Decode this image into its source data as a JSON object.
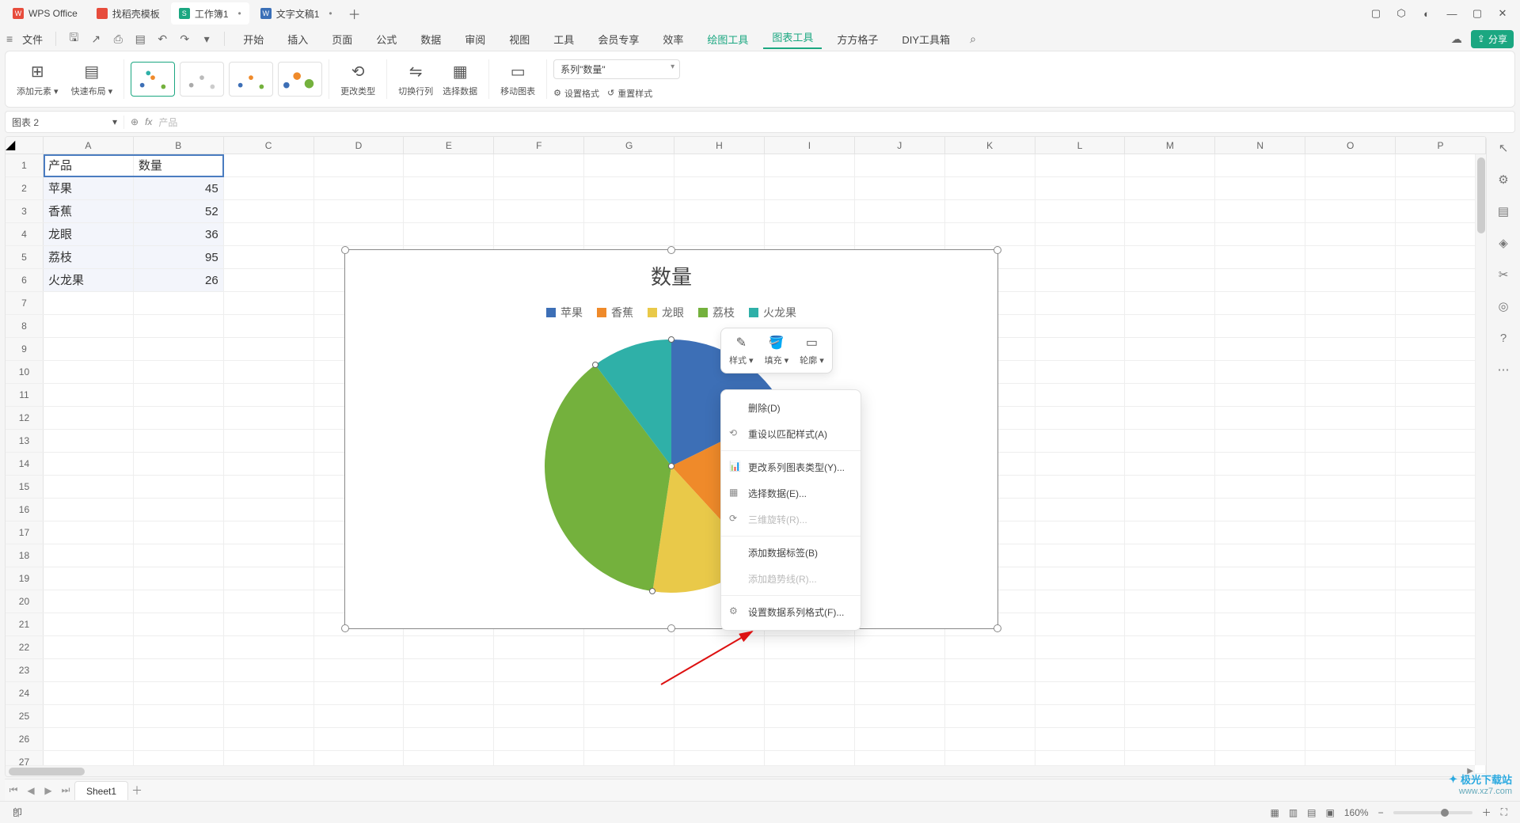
{
  "titlebar": {
    "app": "WPS Office",
    "tabs": [
      {
        "label": "找稻壳模板",
        "icon_color": "#e74c3c"
      },
      {
        "label": "工作簿1",
        "icon_color": "#1ba781",
        "active": true,
        "dirty": "•"
      },
      {
        "label": "文字文稿1",
        "icon_color": "#3a6fb7",
        "dirty": "•"
      }
    ],
    "newtab": "＋"
  },
  "menubar": {
    "file": "文件",
    "items": [
      "开始",
      "插入",
      "页面",
      "公式",
      "数据",
      "审阅",
      "视图",
      "工具",
      "会员专享",
      "效率"
    ],
    "green_items": [
      "绘图工具",
      "图表工具"
    ],
    "active_green": "图表工具",
    "extra_items": [
      "方方格子",
      "DIY工具箱"
    ],
    "share": "分享"
  },
  "ribbon": {
    "add_element": "添加元素",
    "quick_layout": "快速布局",
    "change_type": "更改类型",
    "swap_rc": "切换行列",
    "select_data": "选择数据",
    "move_chart": "移动图表",
    "series_dropdown": "系列\"数量\"",
    "set_format": "设置格式",
    "reset_style": "重置样式"
  },
  "formulabar": {
    "namebox": "图表 2",
    "content": "产品",
    "fx": "fx"
  },
  "grid": {
    "cols": [
      "A",
      "B",
      "C",
      "D",
      "E",
      "F",
      "G",
      "H",
      "I",
      "J",
      "K",
      "L",
      "M",
      "N",
      "O",
      "P"
    ],
    "headers": {
      "A": "产品",
      "B": "数量"
    },
    "rows": [
      {
        "A": "苹果",
        "B": 45
      },
      {
        "A": "香蕉",
        "B": 52
      },
      {
        "A": "龙眼",
        "B": 36
      },
      {
        "A": "荔枝",
        "B": 95
      },
      {
        "A": "火龙果",
        "B": 26
      }
    ],
    "visible_row_count": 27
  },
  "chart_data": {
    "type": "pie",
    "title": "数量",
    "categories": [
      "苹果",
      "香蕉",
      "龙眼",
      "荔枝",
      "火龙果"
    ],
    "values": [
      45,
      52,
      36,
      95,
      26
    ],
    "colors": [
      "#3d6fb6",
      "#ef8a2a",
      "#e9c949",
      "#74b13d",
      "#2fb0a8"
    ],
    "legend_position": "top"
  },
  "minitool": {
    "style": "样式",
    "fill": "填充",
    "outline": "轮廓"
  },
  "contextmenu": {
    "delete": "删除(D)",
    "reset_match": "重设以匹配样式(A)",
    "change_series_type": "更改系列图表类型(Y)...",
    "select_data": "选择数据(E)...",
    "rotate3d": "三维旋转(R)...",
    "add_labels": "添加数据标签(B)",
    "add_trend": "添加趋势线(R)...",
    "format_series": "设置数据系列格式(F)..."
  },
  "sheettabs": {
    "sheet": "Sheet1"
  },
  "statusbar": {
    "ready": "卽",
    "zoom": "160%"
  },
  "watermark": {
    "line1": "极光下载站",
    "line2": "www.xz7.com"
  },
  "icons": {
    "search": "⌕",
    "gear": "⚙",
    "chevron_down": "▾"
  }
}
